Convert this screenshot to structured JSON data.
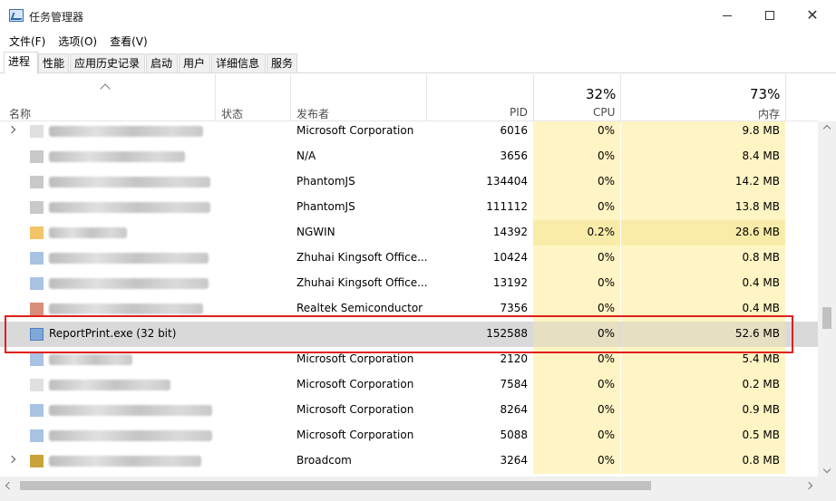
{
  "window": {
    "title": "任务管理器"
  },
  "menu": [
    "文件(F)",
    "选项(O)",
    "查看(V)"
  ],
  "tabs": [
    "进程",
    "性能",
    "应用历史记录",
    "启动",
    "用户",
    "详细信息",
    "服务"
  ],
  "header": {
    "name": "名称",
    "status": "状态",
    "publisher": "发布者",
    "pid": "PID",
    "cpu_pct": "32%",
    "cpu": "CPU",
    "mem_pct": "73%",
    "mem": "内存"
  },
  "rows": [
    {
      "publisher": "Microsoft Corporation",
      "pid": "6016",
      "cpu": "0%",
      "mem": "9.8 MB"
    },
    {
      "publisher": "N/A",
      "pid": "3656",
      "cpu": "0%",
      "mem": "8.4 MB"
    },
    {
      "publisher": "PhantomJS",
      "pid": "134404",
      "cpu": "0%",
      "mem": "14.2 MB"
    },
    {
      "publisher": "PhantomJS",
      "pid": "111112",
      "cpu": "0%",
      "mem": "13.8 MB"
    },
    {
      "publisher": "NGWIN",
      "pid": "14392",
      "cpu": "0.2%",
      "mem": "28.6 MB"
    },
    {
      "publisher": "Zhuhai Kingsoft Office...",
      "pid": "10424",
      "cpu": "0%",
      "mem": "0.8 MB"
    },
    {
      "publisher": "Zhuhai Kingsoft Office...",
      "pid": "13192",
      "cpu": "0%",
      "mem": "0.4 MB"
    },
    {
      "publisher": "Realtek Semiconductor",
      "pid": "7356",
      "cpu": "0%",
      "mem": "0.4 MB"
    },
    {
      "name": "ReportPrint.exe (32 bit)",
      "publisher": "",
      "pid": "152588",
      "cpu": "0%",
      "mem": "52.6 MB"
    },
    {
      "publisher": "Microsoft Corporation",
      "pid": "2120",
      "cpu": "0%",
      "mem": "5.4 MB"
    },
    {
      "publisher": "Microsoft Corporation",
      "pid": "7584",
      "cpu": "0%",
      "mem": "0.2 MB"
    },
    {
      "publisher": "Microsoft Corporation",
      "pid": "8264",
      "cpu": "0%",
      "mem": "0.9 MB"
    },
    {
      "publisher": "Microsoft Corporation",
      "pid": "5088",
      "cpu": "0%",
      "mem": "0.5 MB"
    },
    {
      "publisher": "Broadcom",
      "pid": "3264",
      "cpu": "0%",
      "mem": "0.8 MB"
    }
  ],
  "colors": {
    "cpu_heat": "#fff4c4",
    "selection": "#d9d9d9",
    "highlight_border": "#e0201b"
  },
  "icons": [
    "task-manager-icon",
    "minimize-icon",
    "maximize-icon",
    "close-icon",
    "sort-up-icon",
    "chevron-right-icon"
  ]
}
